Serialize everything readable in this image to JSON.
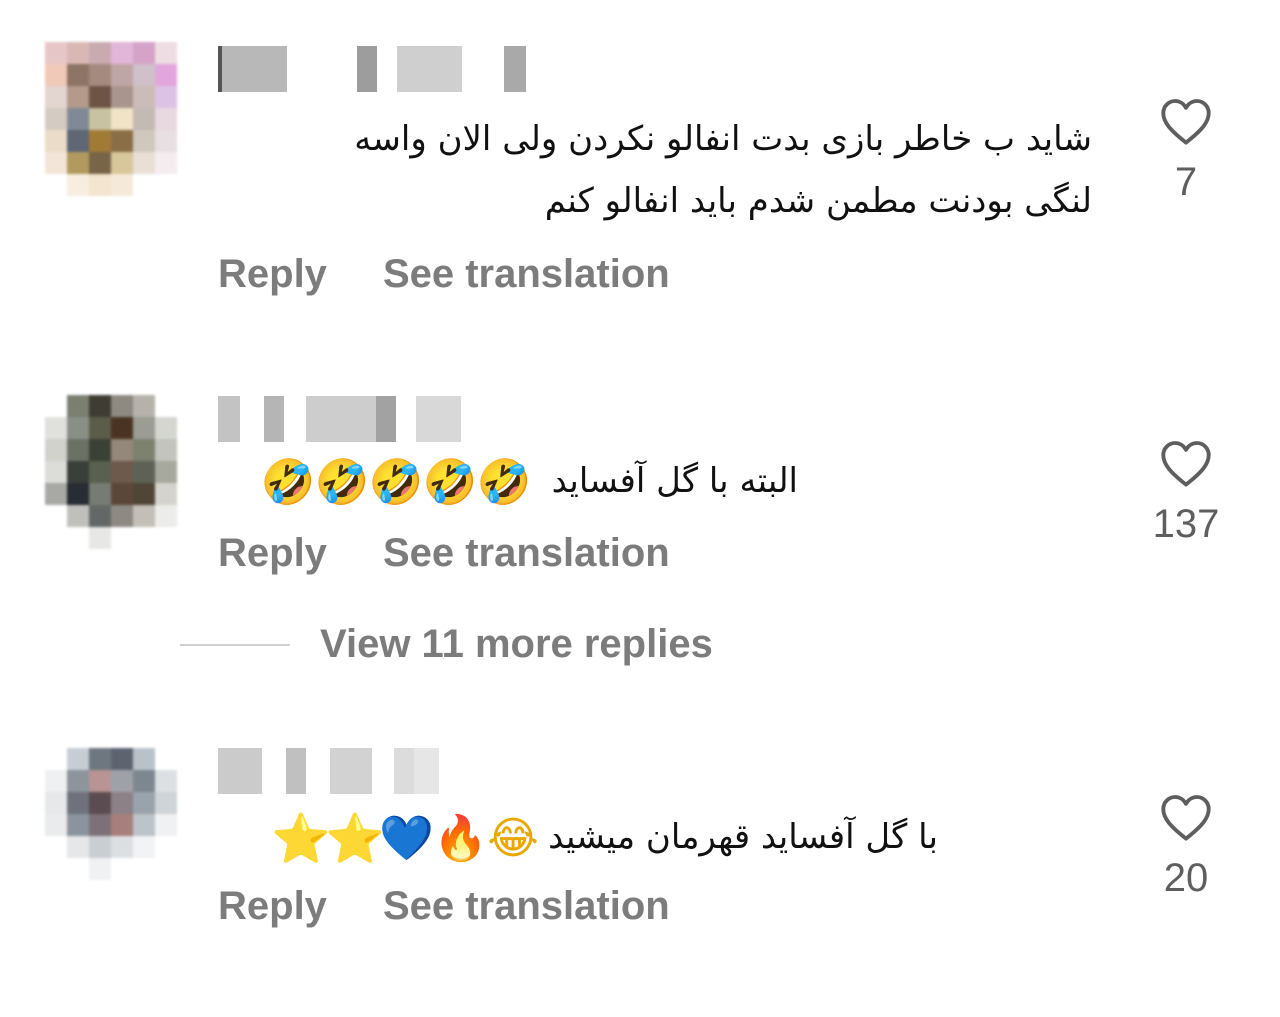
{
  "comments": [
    {
      "text_line1": "شاید ب خاطر بازی بدت انفالو نکردن ولی الان واسه",
      "text_line2": "لنگی بودنت مطمن شدم باید انفالو کنم",
      "reply_label": "Reply",
      "translate_label": "See translation",
      "like_icon": "heart-outline-icon",
      "like_count": "7"
    },
    {
      "text": "البته با گل آفساید",
      "emojis": [
        "🤣",
        "🤣",
        "🤣",
        "🤣",
        "🤣"
      ],
      "reply_label": "Reply",
      "translate_label": "See translation",
      "like_icon": "heart-outline-icon",
      "like_count": "137"
    },
    {
      "text": "با گل آفساید قهرمان میشید",
      "emojis": [
        "😂",
        "🔥",
        "💙",
        "⭐",
        "⭐"
      ],
      "reply_label": "Reply",
      "translate_label": "See translation",
      "like_icon": "heart-outline-icon",
      "like_count": "20"
    }
  ],
  "view_more": {
    "label": "View 11 more replies"
  },
  "colors": {
    "meta_gray": "#7c7c7c",
    "count_gray": "#5e5e5e",
    "divider": "#d0d0d0"
  }
}
